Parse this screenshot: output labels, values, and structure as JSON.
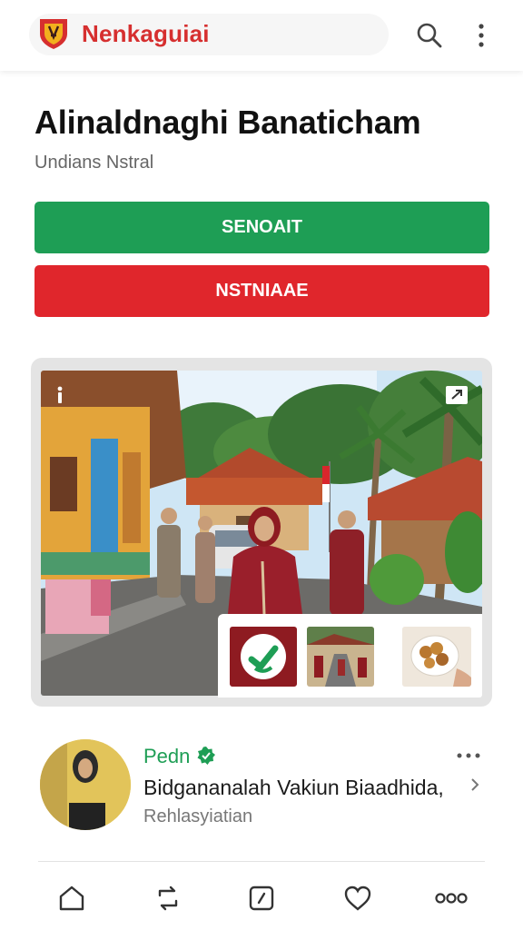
{
  "header": {
    "app_name": "Nenkaguiai",
    "logo_icon": "shield-logo-icon",
    "search_icon": "search-icon",
    "more_icon": "more-vertical-icon"
  },
  "page": {
    "title": "Alinaldnaghi Banaticham",
    "subtitle": "Undians Nstral"
  },
  "actions": {
    "primary_label": "SENOAIT",
    "secondary_label": "NSTNIAAE"
  },
  "colors": {
    "brand": "#d62f2f",
    "primary_button": "#1e9e55",
    "secondary_button": "#e0262c",
    "author": "#1e9e55"
  },
  "media": {
    "info_icon": "info-icon",
    "expand_icon": "expand-icon",
    "thumbnails": [
      "whatsapp-thumbnail",
      "street-thumbnail",
      "food-thumbnail"
    ]
  },
  "post": {
    "author": "Pedn",
    "text": "Bidgananalah Vakiun Biaadhida,",
    "subtext": "Rehlasyiatian"
  },
  "bottom_nav": [
    "home-icon",
    "repost-icon",
    "compose-icon",
    "heart-icon",
    "more-horizontal-icon"
  ]
}
